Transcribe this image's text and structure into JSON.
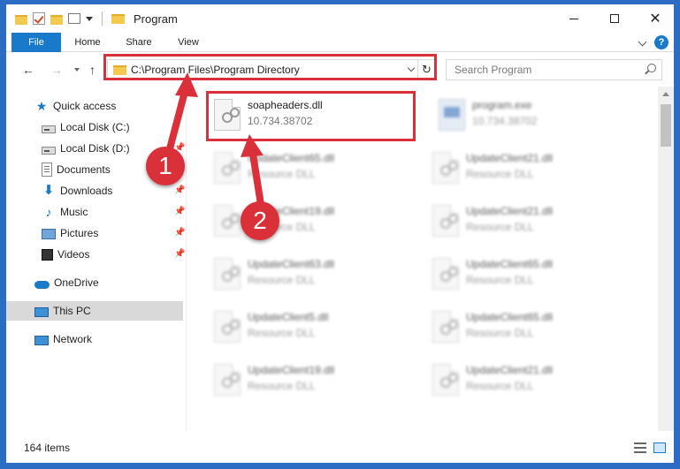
{
  "window": {
    "title": "Program"
  },
  "ribbon": {
    "tabs": [
      "File",
      "Home",
      "Share",
      "View"
    ],
    "help": "?"
  },
  "navbar": {
    "address": "C:\\Program Files\\Program Directory",
    "search_placeholder": "Search Program"
  },
  "sidebar": {
    "items": [
      {
        "label": "Quick access",
        "icon": "star-icon"
      },
      {
        "label": "Local Disk (C:)",
        "icon": "disk-icon"
      },
      {
        "label": "Local Disk (D:)",
        "icon": "disk-icon"
      },
      {
        "label": "Documents",
        "icon": "documents-icon"
      },
      {
        "label": "Downloads",
        "icon": "download-icon"
      },
      {
        "label": "Music",
        "icon": "music-icon"
      },
      {
        "label": "Pictures",
        "icon": "pictures-icon"
      },
      {
        "label": "Videos",
        "icon": "videos-icon"
      },
      {
        "label": "OneDrive",
        "icon": "cloud-icon"
      },
      {
        "label": "This PC",
        "icon": "computer-icon"
      },
      {
        "label": "Network",
        "icon": "network-icon"
      }
    ]
  },
  "files": [
    {
      "name": "soapheaders.dll",
      "desc": "10.734.38702"
    },
    {
      "name": "program.exe",
      "desc": "10.734.38702"
    },
    {
      "name": "UpdateClient65.dll",
      "desc": "Resource DLL"
    },
    {
      "name": "UpdateClient21.dll",
      "desc": "Resource DLL"
    },
    {
      "name": "UpdateClient19.dll",
      "desc": "Resource DLL"
    },
    {
      "name": "UpdateClient21.dll",
      "desc": "Resource DLL"
    },
    {
      "name": "UpdateClient63.dll",
      "desc": "Resource DLL"
    },
    {
      "name": "UpdateClient65.dll",
      "desc": "Resource DLL"
    },
    {
      "name": "UpdateClient5.dll",
      "desc": "Resource DLL"
    },
    {
      "name": "UpdateClient65.dll",
      "desc": "Resource DLL"
    },
    {
      "name": "UpdateClient19.dll",
      "desc": "Resource DLL"
    },
    {
      "name": "UpdateClient21.dll",
      "desc": "Resource DLL"
    }
  ],
  "status": {
    "item_count": "164 items"
  },
  "annotations": {
    "step1": "1",
    "step2": "2",
    "color": "#d9303a"
  }
}
